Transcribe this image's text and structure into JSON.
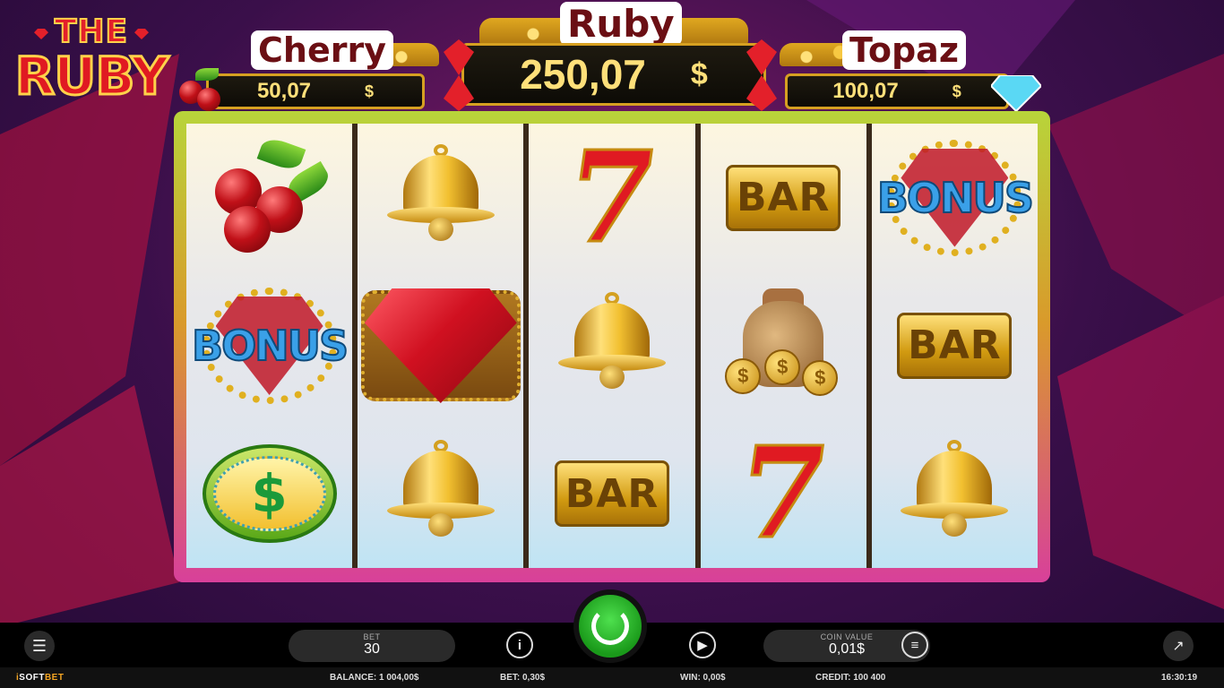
{
  "logo": {
    "line1": "THE",
    "line2": "RUBY"
  },
  "jackpots": {
    "cherry": {
      "title": "Cherry",
      "value": "50,07",
      "currency": "$"
    },
    "ruby": {
      "title": "Ruby",
      "value": "250,07",
      "currency": "$"
    },
    "topaz": {
      "title": "Topaz",
      "value": "100,07",
      "currency": "$"
    }
  },
  "reels": [
    [
      "cherry",
      "bonus",
      "dollar-coin"
    ],
    [
      "bell",
      "ruby",
      "bell"
    ],
    [
      "seven",
      "bell",
      "bar"
    ],
    [
      "bar",
      "money-bag",
      "seven"
    ],
    [
      "bonus",
      "bar",
      "bell"
    ]
  ],
  "symbol_text": {
    "bar": "BAR",
    "bonus": "BONUS",
    "seven": "7",
    "dollar": "$"
  },
  "controls": {
    "bet_label": "BET",
    "bet_value": "30",
    "coin_value_label": "COIN VALUE",
    "coin_value": "0,01$"
  },
  "status": {
    "brand_prefix": "i",
    "brand_soft": "SOFT",
    "brand_bet": "BET",
    "balance": "BALANCE: 1 004,00$",
    "bet": "BET: 0,30$",
    "win": "WIN: 0,00$",
    "credit": "CREDIT:  100 400",
    "time": "16:30:19"
  },
  "colors": {
    "frame_top": "#b8d43a",
    "frame_bottom": "#d8409a",
    "spin_button": "#1a9a1a"
  }
}
